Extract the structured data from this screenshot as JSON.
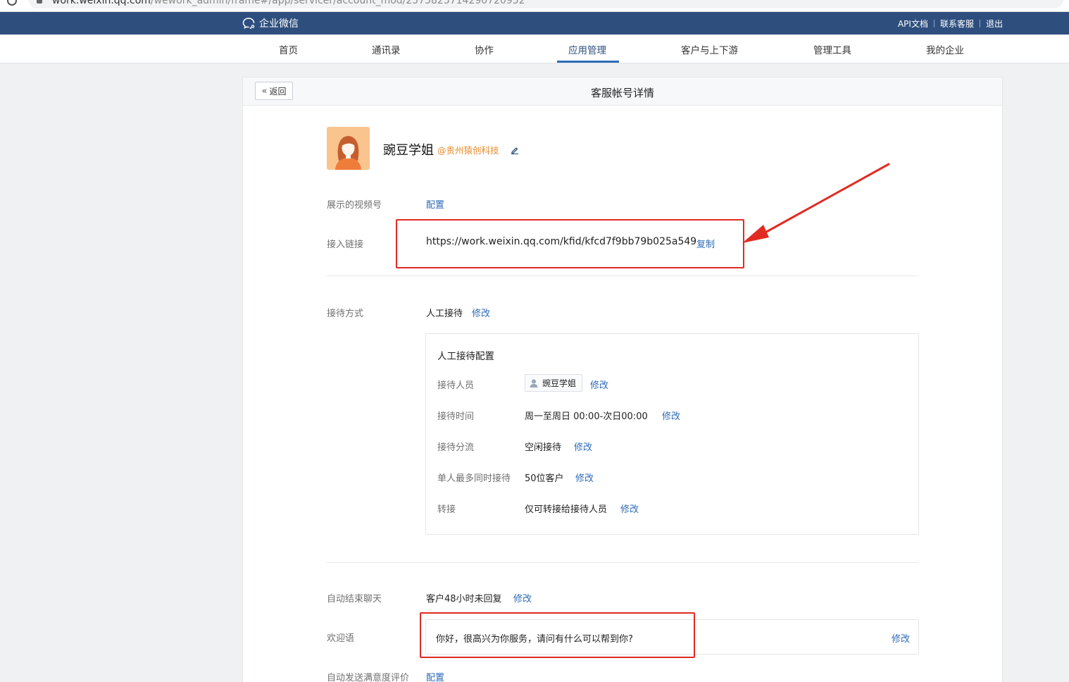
{
  "browser": {
    "url_host": "work.weixin.qq.com",
    "url_path": "/wework_admin/frame#/app/servicer/account_mod/2575825714290720952"
  },
  "topbar": {
    "brand": "企业微信",
    "links": [
      "API文档",
      "联系客服",
      "退出"
    ]
  },
  "nav": {
    "items": [
      "首页",
      "通讯录",
      "协作",
      "应用管理",
      "客户与上下游",
      "管理工具",
      "我的企业"
    ],
    "active": "应用管理"
  },
  "page": {
    "back_label": "返回",
    "title": "客服帐号详情"
  },
  "profile": {
    "name": "豌豆学姐",
    "corp": "@贵州猿创科技"
  },
  "fields": {
    "video_channel": {
      "label": "展示的视频号",
      "action": "配置"
    },
    "access_link": {
      "label": "接入链接",
      "value": "https://work.weixin.qq.com/kfid/kfcd7f9bb79b025a549",
      "action": "复制"
    },
    "reception_mode": {
      "label": "接待方式",
      "value": "人工接待",
      "action": "修改"
    },
    "auto_end": {
      "label": "自动结束聊天",
      "value": "客户48小时未回复",
      "action": "修改"
    },
    "welcome": {
      "label": "欢迎语",
      "value": "你好，很高兴为你服务，请问有什么可以帮到你?",
      "action": "修改"
    },
    "satisfaction": {
      "label": "自动发送满意度评价",
      "action": "配置"
    }
  },
  "manual_config": {
    "title": "人工接待配置",
    "rows": [
      {
        "label": "接待人员",
        "value": "豌豆学姐",
        "action": "修改"
      },
      {
        "label": "接待时间",
        "value": "周一至周日 00:00-次日00:00",
        "action": "修改"
      },
      {
        "label": "接待分流",
        "value": "空闲接待",
        "action": "修改"
      },
      {
        "label": "单人最多同时接待",
        "value": "50位客户",
        "action": "修改"
      },
      {
        "label": "转接",
        "value": "仅可转接给接待人员",
        "action": "修改"
      }
    ]
  },
  "colors": {
    "topbar": "#2e4f7e",
    "link": "#2e6bb7",
    "corp_tag": "#e88b2b",
    "annotation": "#e12b22"
  }
}
